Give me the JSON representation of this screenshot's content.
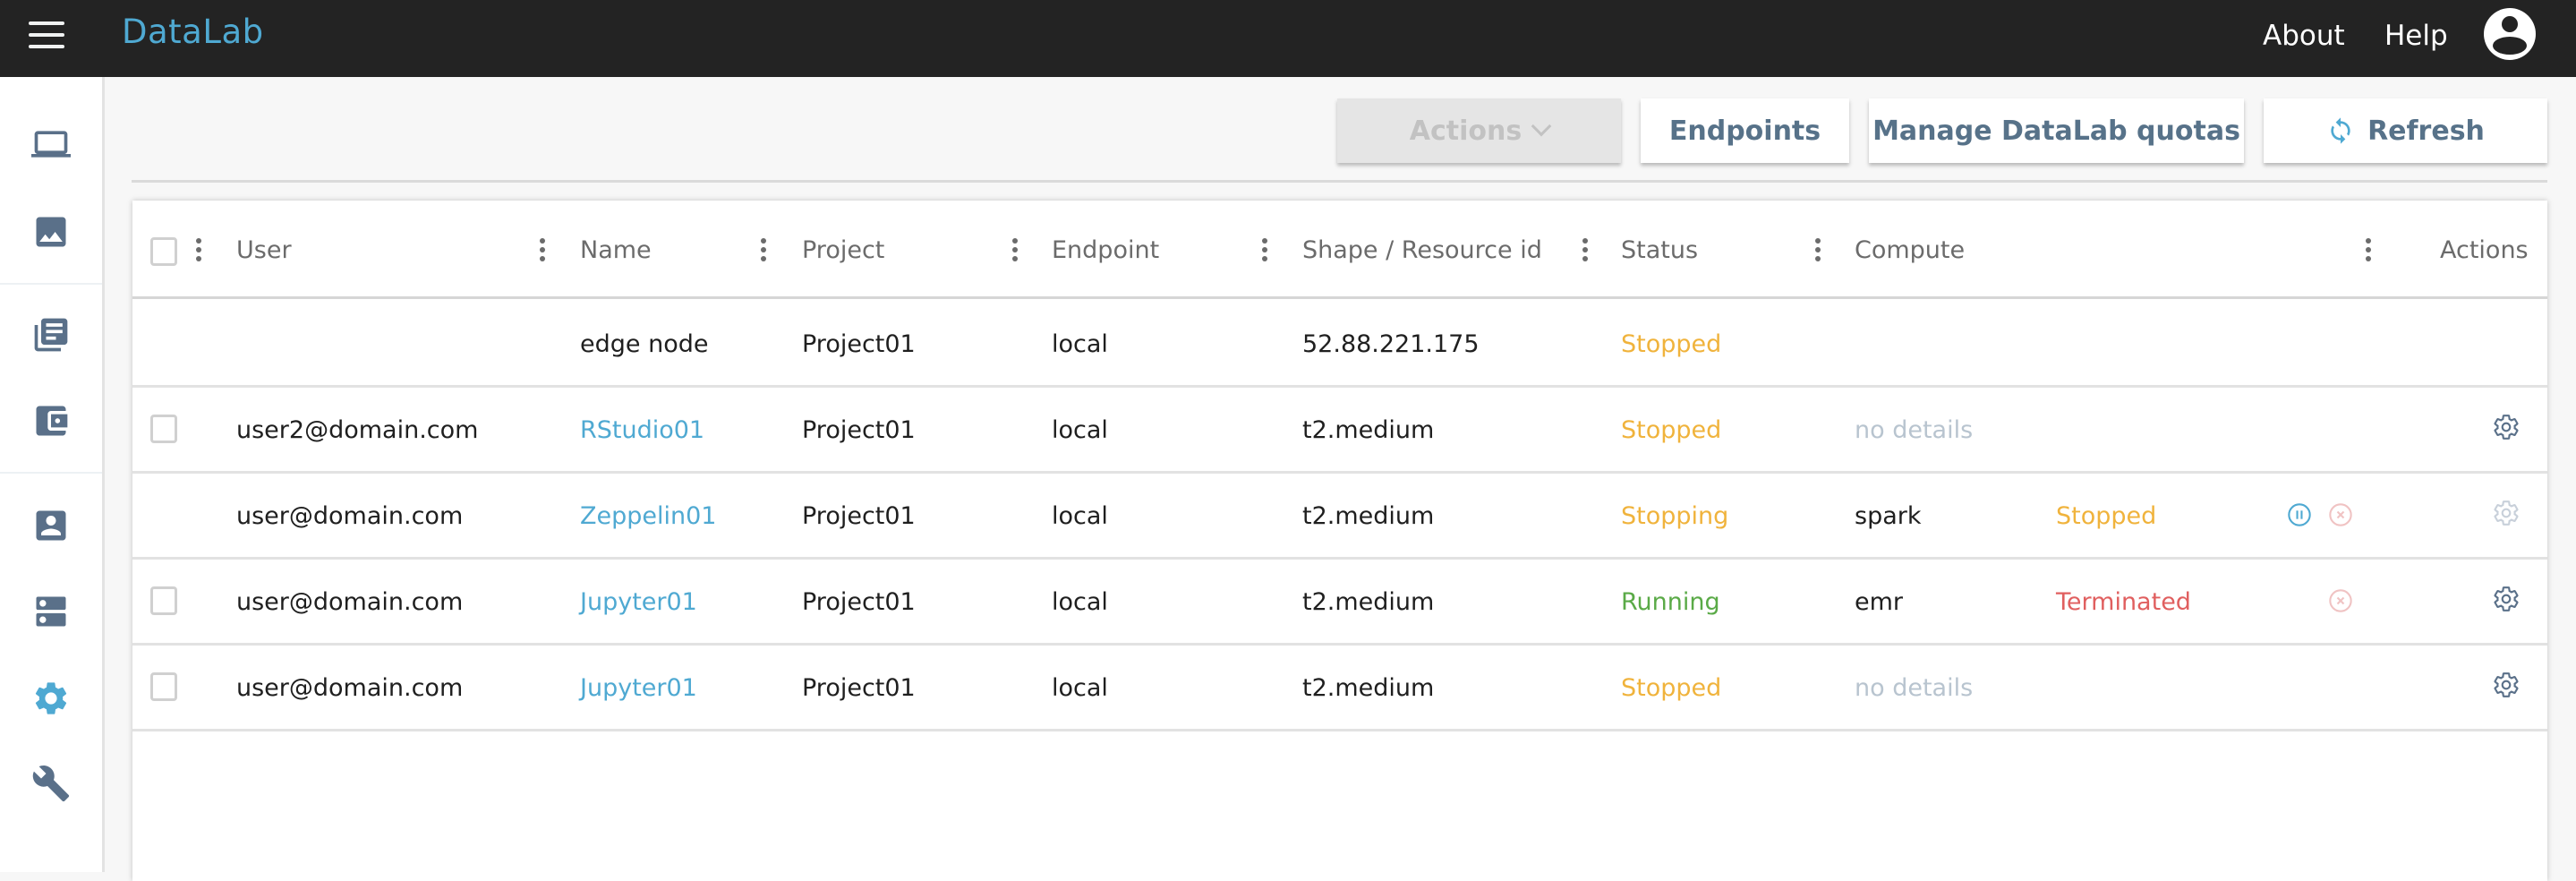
{
  "app": {
    "title": "DataLab",
    "nav": {
      "about": "About",
      "help": "Help"
    }
  },
  "sidebar": {
    "items": [
      {
        "name": "laptop-icon",
        "active": false
      },
      {
        "name": "image-icon",
        "active": false
      },
      {
        "name": "library-icon",
        "active": false
      },
      {
        "name": "wallet-icon",
        "active": false
      },
      {
        "name": "account-box-icon",
        "active": false
      },
      {
        "name": "server-icon",
        "active": false
      },
      {
        "name": "settings-gear-icon",
        "active": true
      },
      {
        "name": "wrench-icon",
        "active": false
      }
    ]
  },
  "toolbar": {
    "actions_label": "Actions",
    "endpoints_label": "Endpoints",
    "quotas_label": "Manage DataLab quotas",
    "refresh_label": "Refresh"
  },
  "colors": {
    "accent": "#4fa9d2",
    "topbar": "#232323",
    "button_text": "#577289",
    "stopped": "#f0b33c",
    "running": "#5aaa47",
    "terminated": "#e05f5f"
  },
  "table": {
    "headers": {
      "user": "User",
      "name": "Name",
      "project": "Project",
      "endpoint": "Endpoint",
      "shape": "Shape / Resource id",
      "status": "Status",
      "compute": "Compute",
      "actions": "Actions"
    },
    "rows": [
      {
        "checkbox": false,
        "user": "",
        "name": "edge node",
        "name_link": false,
        "project": "Project01",
        "endpoint": "local",
        "shape": "52.88.221.175",
        "status": "Stopped",
        "compute": "",
        "compute_status": "",
        "gear": false
      },
      {
        "checkbox": true,
        "user": "user2@domain.com",
        "name": "RStudio01",
        "name_link": true,
        "project": "Project01",
        "endpoint": "local",
        "shape": "t2.medium",
        "status": "Stopped",
        "compute": "no details",
        "compute_status": "",
        "gear": true
      },
      {
        "checkbox": false,
        "user": "user@domain.com",
        "name": "Zeppelin01",
        "name_link": true,
        "project": "Project01",
        "endpoint": "local",
        "shape": "t2.medium",
        "status": "Stopping",
        "compute": "spark",
        "compute_status": "Stopped",
        "gear": true
      },
      {
        "checkbox": true,
        "user": "user@domain.com",
        "name": "Jupyter01",
        "name_link": true,
        "project": "Project01",
        "endpoint": "local",
        "shape": "t2.medium",
        "status": "Running",
        "compute": "emr",
        "compute_status": "Terminated",
        "gear": true
      },
      {
        "checkbox": true,
        "user": "user@domain.com",
        "name": "Jupyter01",
        "name_link": true,
        "project": "Project01",
        "endpoint": "local",
        "shape": "t2.medium",
        "status": "Stopped",
        "compute": "no details",
        "compute_status": "",
        "gear": true
      }
    ]
  }
}
